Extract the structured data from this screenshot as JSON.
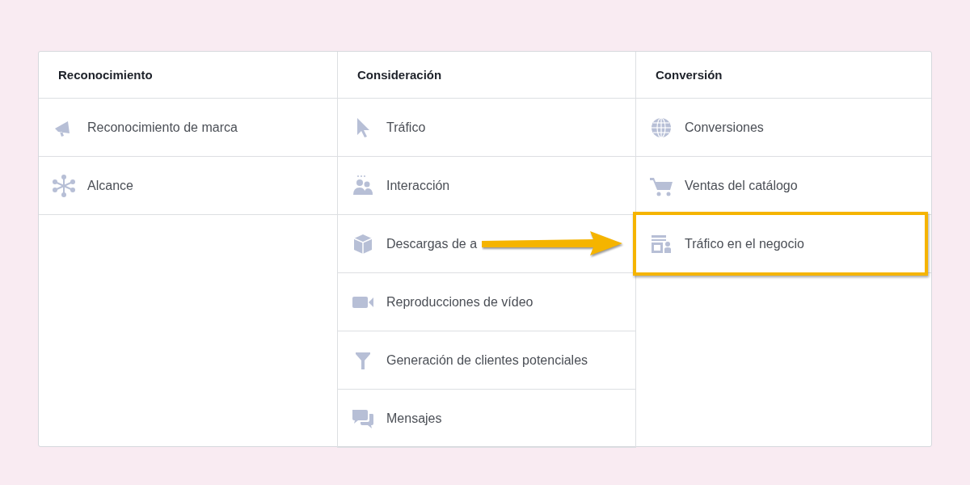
{
  "columns": [
    {
      "title": "Reconocimiento",
      "items": [
        {
          "label": "Reconocimiento de marca",
          "kind": "megaphone",
          "highlighted": false
        },
        {
          "label": "Alcance",
          "kind": "nodes",
          "highlighted": false
        }
      ]
    },
    {
      "title": "Consideración",
      "items": [
        {
          "label": "Tráfico",
          "kind": "cursor",
          "highlighted": false
        },
        {
          "label": "Interacción",
          "kind": "people",
          "highlighted": false
        },
        {
          "label": "Descargas de a",
          "kind": "cube",
          "highlighted": false
        },
        {
          "label": "Reproducciones de vídeo",
          "kind": "video",
          "highlighted": false
        },
        {
          "label": "Generación de clientes potenciales",
          "kind": "funnel",
          "highlighted": false
        },
        {
          "label": "Mensajes",
          "kind": "chat",
          "highlighted": false
        }
      ]
    },
    {
      "title": "Conversión",
      "items": [
        {
          "label": "Conversiones",
          "kind": "globe",
          "highlighted": false
        },
        {
          "label": "Ventas del catálogo",
          "kind": "cart",
          "highlighted": false
        },
        {
          "label": "Tráfico en el negocio",
          "kind": "store",
          "highlighted": true
        }
      ]
    }
  ]
}
